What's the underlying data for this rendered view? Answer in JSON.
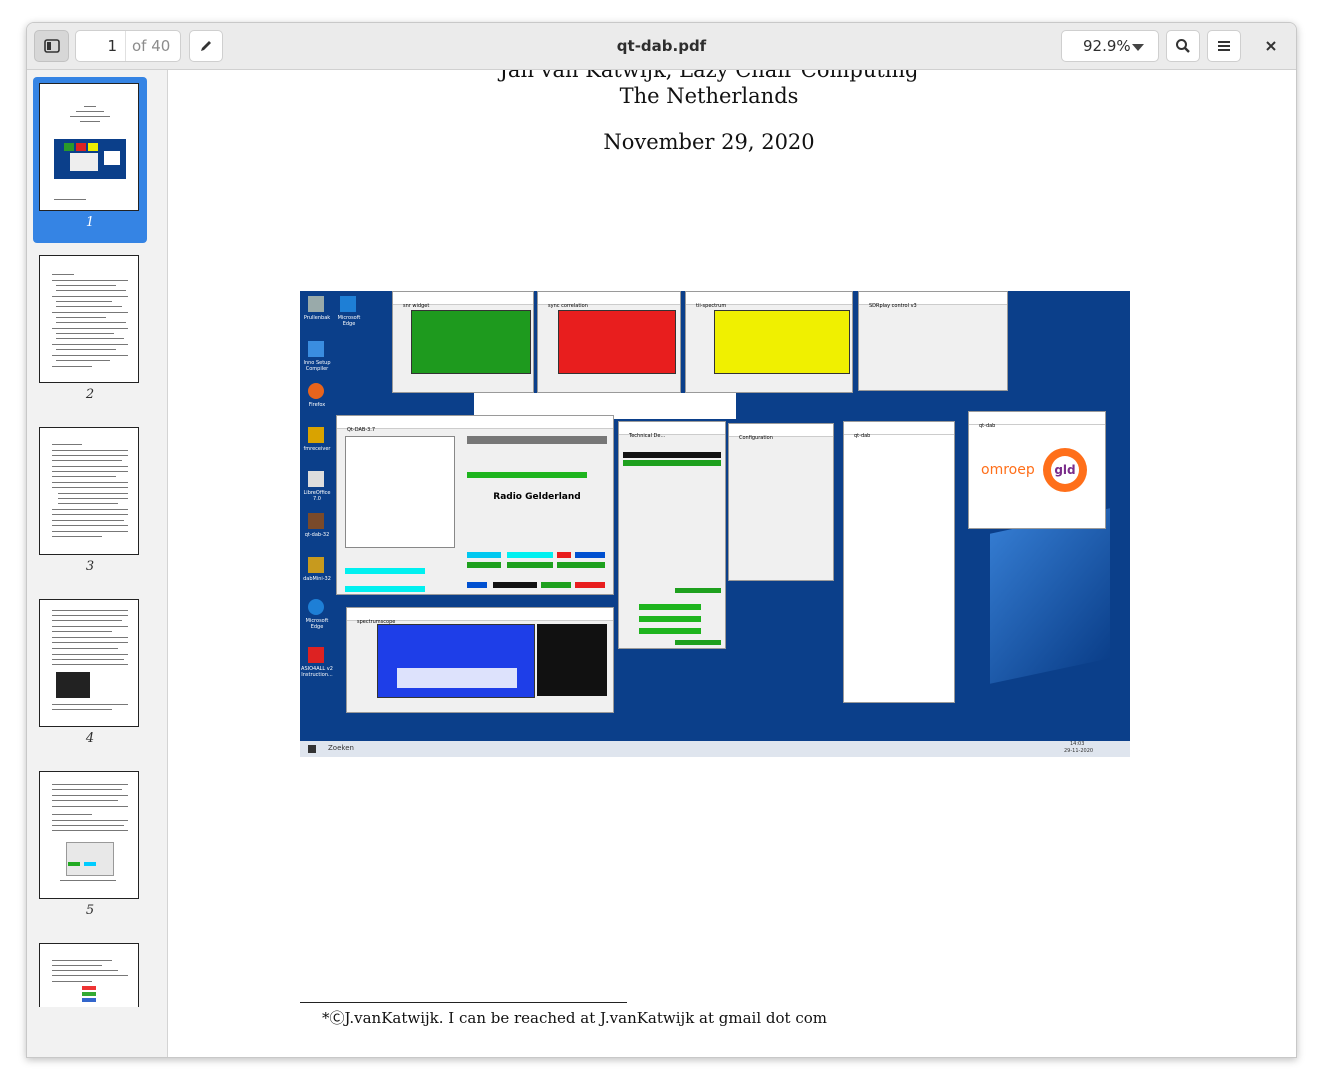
{
  "window": {
    "title": "qt-dab.pdf"
  },
  "toolbar": {
    "current_page": "1",
    "total_pages": "of 40",
    "zoom": "92.9%"
  },
  "sidebar": {
    "thumbnails": [
      {
        "label": "1",
        "selected": true
      },
      {
        "label": "2",
        "selected": false
      },
      {
        "label": "3",
        "selected": false
      },
      {
        "label": "4",
        "selected": false
      },
      {
        "label": "5",
        "selected": false
      },
      {
        "label": "",
        "selected": false
      }
    ]
  },
  "document": {
    "author_line": "Jan van Katwijk, Lazy Chair Computing",
    "country": "The Netherlands",
    "date": "November 29, 2020",
    "footnote": "*ⒸJ.vanKatwijk. I can be reached at J.vanKatwijk at gmail dot com",
    "page_number": "1",
    "screenshot": {
      "labels": [
        "Prullenbak",
        "Microsoft Edge",
        "Inno Setup Compiler",
        "Firefox",
        "fmreceiver",
        "LibreOffice 7.0",
        "qt-dab-32",
        "dabMini-32",
        "Microsoft Edge",
        "ASIO4ALL v2 Instruction..."
      ],
      "windows": [
        "snr widget",
        "sync correlation",
        "tii-spectrum",
        "SDRplay control v3",
        "Qt-DAB-3.7",
        "Technical De...",
        "Configuration",
        "qt-dab",
        "qt-dab",
        "spectrumscope"
      ],
      "station": "Radio Gelderland",
      "logo_text": "omroep",
      "logo_badge": "gld",
      "search": "Zoeken",
      "clock": "14:03",
      "clock_date": "29-11-2020"
    }
  },
  "colors": {
    "accent": "#3584e4",
    "header_bg": "#ebebeb",
    "sidebar_bg": "#f2f2f2",
    "desktop_bg": "#0b3f8a",
    "logo_orange": "#ff6f1a",
    "logo_purple": "#7a2c8a"
  },
  "icons": [
    "sidebar-toggle-icon",
    "pencil-icon",
    "search-icon",
    "hamburger-menu-icon",
    "close-icon",
    "grid-icon",
    "clipboard-icon",
    "bookmark-icon"
  ]
}
